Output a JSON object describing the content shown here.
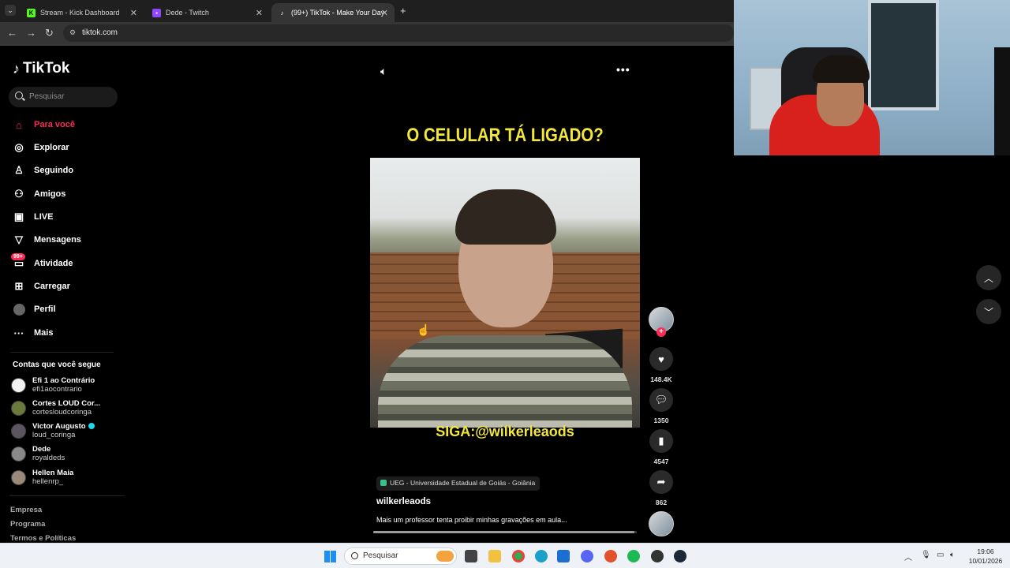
{
  "browser": {
    "tabs": [
      {
        "title": "Stream - Kick Dashboard",
        "favicon": "kick-icon",
        "active": false
      },
      {
        "title": "Dede - Twitch",
        "favicon": "twitch-icon",
        "active": false
      },
      {
        "title": "(99+) TikTok - Make Your Day",
        "favicon": "tiktok-icon",
        "active": true
      }
    ],
    "url": "tiktok.com"
  },
  "sidebar": {
    "logo": "TikTok",
    "search_placeholder": "Pesquisar",
    "nav": [
      {
        "label": "Para você",
        "icon": "home-icon",
        "active": true
      },
      {
        "label": "Explorar",
        "icon": "compass-icon"
      },
      {
        "label": "Seguindo",
        "icon": "following-icon"
      },
      {
        "label": "Amigos",
        "icon": "friends-icon"
      },
      {
        "label": "LIVE",
        "icon": "live-icon"
      },
      {
        "label": "Mensagens",
        "icon": "messages-icon"
      },
      {
        "label": "Atividade",
        "icon": "activity-icon",
        "badge": "99+"
      },
      {
        "label": "Carregar",
        "icon": "upload-icon"
      },
      {
        "label": "Perfil",
        "icon": "profile-icon"
      },
      {
        "label": "Mais",
        "icon": "more-icon"
      }
    ],
    "following_title": "Contas que você segue",
    "following": [
      {
        "name": "Efi 1 ao Contrário",
        "handle": "efi1aocontrario",
        "verified": false
      },
      {
        "name": "Cortes LOUD Cor...",
        "handle": "cortesloudcoringa",
        "verified": false
      },
      {
        "name": "Victor Augusto",
        "handle": "loud_coringa",
        "verified": true
      },
      {
        "name": "Dede",
        "handle": "royaldeds",
        "verified": false
      },
      {
        "name": "Hellen Maia",
        "handle": "hellenrp_",
        "verified": false
      }
    ],
    "footer": [
      "Empresa",
      "Programa",
      "Termos e Políticas"
    ]
  },
  "video": {
    "overlay_title": "O CELULAR TÁ LIGADO?",
    "overlay_caption": "SIGA:@wilkerleaods",
    "location": "UEG - Universidade Estadual de Goiás - Goiânia",
    "author": "wilkerleaods",
    "description": "Mais um professor tenta proibir minhas gravações em aula...",
    "progress_fraction": 0.99
  },
  "actions": {
    "likes": "148.4K",
    "comments": "1350",
    "saves": "4547",
    "shares": "862"
  },
  "taskbar": {
    "search_placeholder": "Pesquisar",
    "time": "19:06",
    "date": "10/01/2026"
  },
  "colors": {
    "accent": "#fe2c55",
    "overlay_text": "#f3e83a"
  }
}
